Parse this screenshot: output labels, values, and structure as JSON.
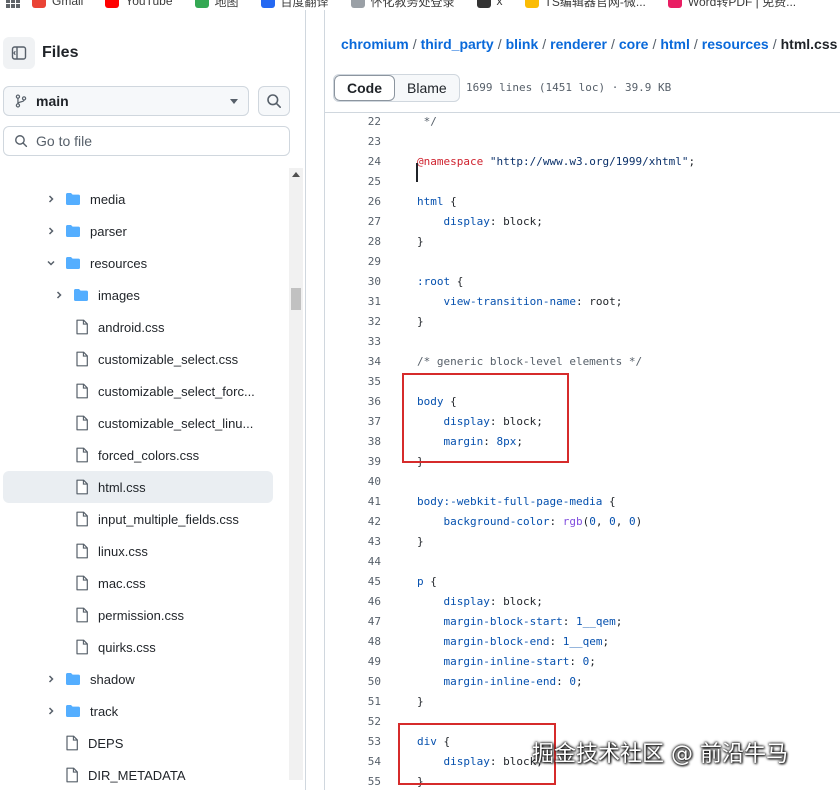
{
  "bookmarks": [
    {
      "label": "Gmail",
      "color": "#ea4335"
    },
    {
      "label": "YouTube",
      "color": "#ff0000"
    },
    {
      "label": "地图",
      "color": "#34a853"
    },
    {
      "label": "百度翻译",
      "color": "#2468f2"
    },
    {
      "label": "怀化教务处登录",
      "color": "#9aa0a6"
    },
    {
      "label": "x",
      "color": "#333333"
    },
    {
      "label": "TS编辑器官网-微...",
      "color": "#fbbc04"
    },
    {
      "label": "Word转PDF | 免费...",
      "color": "#e91e63"
    }
  ],
  "sidebar": {
    "title": "Files",
    "branch": "main",
    "goto_placeholder": "Go to file",
    "tree": [
      {
        "label": "media",
        "type": "folder",
        "depth": 0,
        "expanded": false
      },
      {
        "label": "parser",
        "type": "folder",
        "depth": 0,
        "expanded": false
      },
      {
        "label": "resources",
        "type": "folder",
        "depth": 0,
        "expanded": true
      },
      {
        "label": "images",
        "type": "folder",
        "depth": 1,
        "expanded": false
      },
      {
        "label": "android.css",
        "type": "file",
        "depth": 1
      },
      {
        "label": "customizable_select.css",
        "type": "file",
        "depth": 1
      },
      {
        "label": "customizable_select_forc...",
        "type": "file",
        "depth": 1
      },
      {
        "label": "customizable_select_linu...",
        "type": "file",
        "depth": 1
      },
      {
        "label": "forced_colors.css",
        "type": "file",
        "depth": 1
      },
      {
        "label": "html.css",
        "type": "file",
        "depth": 1,
        "selected": true
      },
      {
        "label": "input_multiple_fields.css",
        "type": "file",
        "depth": 1
      },
      {
        "label": "linux.css",
        "type": "file",
        "depth": 1
      },
      {
        "label": "mac.css",
        "type": "file",
        "depth": 1
      },
      {
        "label": "permission.css",
        "type": "file",
        "depth": 1
      },
      {
        "label": "quirks.css",
        "type": "file",
        "depth": 1
      },
      {
        "label": "shadow",
        "type": "folder",
        "depth": 0,
        "expanded": false
      },
      {
        "label": "track",
        "type": "folder",
        "depth": 0,
        "expanded": false
      },
      {
        "label": "DEPS",
        "type": "file",
        "depth": 0
      },
      {
        "label": "DIR_METADATA",
        "type": "file",
        "depth": 0
      }
    ]
  },
  "breadcrumb": {
    "parts": [
      "chromium",
      "third_party",
      "blink",
      "renderer",
      "core",
      "html",
      "resources"
    ],
    "current": "html.css"
  },
  "toolbar": {
    "code_tab": "Code",
    "blame_tab": "Blame",
    "file_info": "1699 lines (1451 loc) · 39.9 KB"
  },
  "code_lines": [
    {
      "n": 22,
      "t": [
        [
          " */",
          "com"
        ]
      ]
    },
    {
      "n": 23,
      "t": []
    },
    {
      "n": 24,
      "t": [
        [
          "@namespace",
          "at"
        ],
        [
          " ",
          ""
        ],
        [
          "\"http://www.w3.org/1999/xhtml\"",
          "str"
        ],
        [
          ";",
          ""
        ]
      ]
    },
    {
      "n": 25,
      "t": []
    },
    {
      "n": 26,
      "t": [
        [
          "html",
          "sel"
        ],
        [
          " {",
          ""
        ]
      ]
    },
    {
      "n": 27,
      "t": [
        [
          "    ",
          ""
        ],
        [
          "display",
          "prop"
        ],
        [
          ": block;",
          ""
        ]
      ]
    },
    {
      "n": 28,
      "t": [
        [
          "}",
          ""
        ]
      ]
    },
    {
      "n": 29,
      "t": []
    },
    {
      "n": 30,
      "t": [
        [
          ":root",
          "sel"
        ],
        [
          " {",
          ""
        ]
      ]
    },
    {
      "n": 31,
      "t": [
        [
          "    ",
          ""
        ],
        [
          "view-transition-name",
          "prop"
        ],
        [
          ": root;",
          ""
        ]
      ]
    },
    {
      "n": 32,
      "t": [
        [
          "}",
          ""
        ]
      ]
    },
    {
      "n": 33,
      "t": []
    },
    {
      "n": 34,
      "t": [
        [
          "/* generic block-level elements */",
          "com"
        ]
      ]
    },
    {
      "n": 35,
      "t": []
    },
    {
      "n": 36,
      "t": [
        [
          "body",
          "sel"
        ],
        [
          " {",
          ""
        ]
      ]
    },
    {
      "n": 37,
      "t": [
        [
          "    ",
          ""
        ],
        [
          "display",
          "prop"
        ],
        [
          ": block;",
          ""
        ]
      ]
    },
    {
      "n": 38,
      "t": [
        [
          "    ",
          ""
        ],
        [
          "margin",
          "prop"
        ],
        [
          ": ",
          ""
        ],
        [
          "8px",
          "num"
        ],
        [
          ";",
          ""
        ]
      ]
    },
    {
      "n": 39,
      "t": [
        [
          "}",
          ""
        ]
      ]
    },
    {
      "n": 40,
      "t": []
    },
    {
      "n": 41,
      "t": [
        [
          "body:-webkit-full-page-media",
          "sel"
        ],
        [
          " {",
          ""
        ]
      ]
    },
    {
      "n": 42,
      "t": [
        [
          "    ",
          ""
        ],
        [
          "background-color",
          "prop"
        ],
        [
          ": ",
          ""
        ],
        [
          "rgb",
          "fn"
        ],
        [
          "(",
          ""
        ],
        [
          "0",
          "num"
        ],
        [
          ", ",
          ""
        ],
        [
          "0",
          "num"
        ],
        [
          ", ",
          ""
        ],
        [
          "0",
          "num"
        ],
        [
          ")",
          ""
        ]
      ]
    },
    {
      "n": 43,
      "t": [
        [
          "}",
          ""
        ]
      ]
    },
    {
      "n": 44,
      "t": []
    },
    {
      "n": 45,
      "t": [
        [
          "p",
          "sel"
        ],
        [
          " {",
          ""
        ]
      ]
    },
    {
      "n": 46,
      "t": [
        [
          "    ",
          ""
        ],
        [
          "display",
          "prop"
        ],
        [
          ": block;",
          ""
        ]
      ]
    },
    {
      "n": 47,
      "t": [
        [
          "    ",
          ""
        ],
        [
          "margin-block-start",
          "prop"
        ],
        [
          ": ",
          ""
        ],
        [
          "1__qem",
          "num"
        ],
        [
          ";",
          ""
        ]
      ]
    },
    {
      "n": 48,
      "t": [
        [
          "    ",
          ""
        ],
        [
          "margin-block-end",
          "prop"
        ],
        [
          ": ",
          ""
        ],
        [
          "1__qem",
          "num"
        ],
        [
          ";",
          ""
        ]
      ]
    },
    {
      "n": 49,
      "t": [
        [
          "    ",
          ""
        ],
        [
          "margin-inline-start",
          "prop"
        ],
        [
          ": ",
          ""
        ],
        [
          "0",
          "num"
        ],
        [
          ";",
          ""
        ]
      ]
    },
    {
      "n": 50,
      "t": [
        [
          "    ",
          ""
        ],
        [
          "margin-inline-end",
          "prop"
        ],
        [
          ": ",
          ""
        ],
        [
          "0",
          "num"
        ],
        [
          ";",
          ""
        ]
      ]
    },
    {
      "n": 51,
      "t": [
        [
          "}",
          ""
        ]
      ]
    },
    {
      "n": 52,
      "t": []
    },
    {
      "n": 53,
      "t": [
        [
          "div",
          "sel"
        ],
        [
          " {",
          ""
        ]
      ]
    },
    {
      "n": 54,
      "t": [
        [
          "    ",
          ""
        ],
        [
          "display",
          "prop"
        ],
        [
          ": block;",
          ""
        ]
      ]
    },
    {
      "n": 55,
      "t": [
        [
          "}",
          ""
        ]
      ]
    }
  ],
  "watermark": "掘金技术社区 @ 前沿牛马",
  "colors": {
    "link": "#0969da",
    "highlight_box": "#d62b2b",
    "folder": "#54aeff"
  }
}
